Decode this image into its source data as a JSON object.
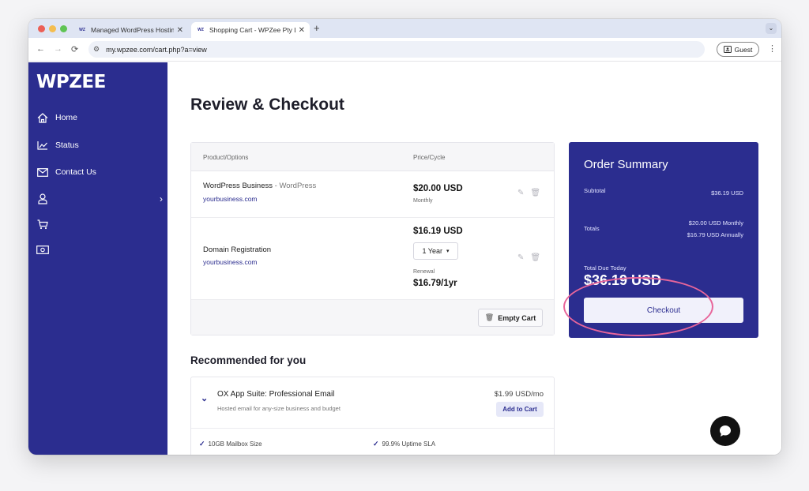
{
  "browser": {
    "tabs": [
      {
        "title": "Managed WordPress Hosting",
        "favicon": "WZ"
      },
      {
        "title": "Shopping Cart - WPZee Pty Ltd",
        "favicon": "WZ"
      }
    ],
    "new_tab_icon": "+",
    "tab_menu_icon": "chevron-down",
    "url": "my.wpzee.com/cart.php?a=view",
    "guest_label": "Guest"
  },
  "sidebar": {
    "logo": "WPZEE",
    "items": [
      {
        "label": "Home",
        "icon": "home-icon"
      },
      {
        "label": "Status",
        "icon": "chart-icon"
      },
      {
        "label": "Contact Us",
        "icon": "mail-icon"
      },
      {
        "label": "",
        "icon": "user-icon"
      },
      {
        "label": "",
        "icon": "cart-icon"
      },
      {
        "label": "",
        "icon": "money-icon"
      }
    ]
  },
  "page": {
    "title": "Review & Checkout"
  },
  "cart": {
    "header": {
      "product": "Product/Options",
      "price": "Price/Cycle"
    },
    "items": [
      {
        "name": "WordPress Business",
        "sub": " - WordPress",
        "domain": "yourbusiness.com",
        "price": "$20.00 USD",
        "cycle": "Monthly"
      },
      {
        "name": "Domain Registration",
        "domain": "yourbusiness.com",
        "price": "$16.19 USD",
        "term": "1 Year",
        "renewal_label": "Renewal",
        "renewal_price": "$16.79/1yr"
      }
    ],
    "empty_cart_label": "Empty Cart"
  },
  "summary": {
    "title": "Order Summary",
    "subtotal_label": "Subtotal",
    "subtotal_value": "$36.19 USD",
    "totals_label": "Totals",
    "totals_monthly": "$20.00 USD Monthly",
    "totals_annually": "$16.79 USD Annually",
    "due_label": "Total Due Today",
    "due_amount": "$36.19 USD",
    "checkout_label": "Checkout"
  },
  "recommended": {
    "title": "Recommended for you",
    "product": {
      "name": "OX App Suite: Professional Email",
      "desc": "Hosted email for any-size business and budget",
      "price": "$1.99 USD/mo",
      "add_label": "Add to Cart",
      "features": [
        "10GB Mailbox Size",
        "99.9% Uptime SLA"
      ]
    }
  },
  "colors": {
    "brand": "#2b2d8f",
    "annotation": "#e8659a"
  }
}
